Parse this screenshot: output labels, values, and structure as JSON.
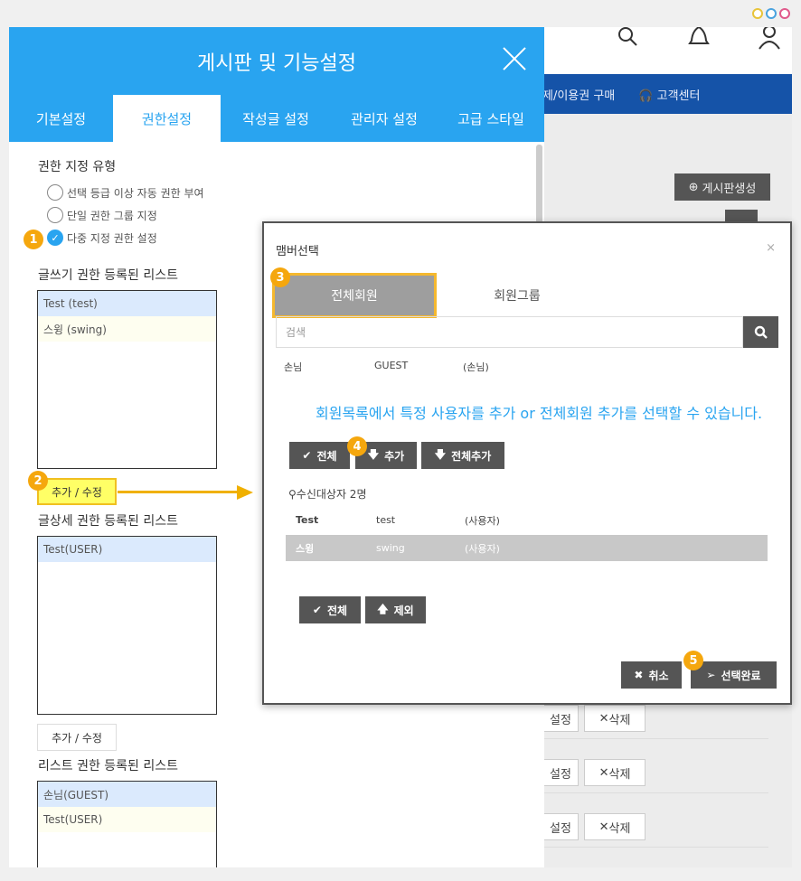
{
  "window_dots": [
    "yellow",
    "blue",
    "pink"
  ],
  "background": {
    "nav_items": [
      "제/이용권 구매",
      "고객센터"
    ],
    "create_board_label": "게시판생성",
    "rows": [
      {
        "edit": "설정",
        "delete": "삭제"
      },
      {
        "edit": "설정",
        "delete": "삭제"
      },
      {
        "edit": "설정",
        "delete": "삭제"
      }
    ]
  },
  "panel": {
    "title": "게시판 및 기능설정",
    "tabs": [
      {
        "label": "기본설정"
      },
      {
        "label": "권한설정"
      },
      {
        "label": "작성글 설정"
      },
      {
        "label": "관리자 설정"
      },
      {
        "label": "고급 스타일"
      }
    ],
    "active_tab": "권한설정",
    "perm_type_label": "권한 지정 유형",
    "radios": [
      {
        "label": "선택 등급 이상 자동 권한 부여",
        "checked": false
      },
      {
        "label": "단일 권한 그룹 지정",
        "checked": false
      },
      {
        "label": "다중 지정 권한 설정",
        "checked": true
      }
    ],
    "write_list_label": "글쓰기 권한 등록된 리스트",
    "write_list": [
      "Test (test)",
      "스윙 (swing)"
    ],
    "detail_list_label": "글상세 권한 등록된 리스트",
    "detail_list": [
      "Test(USER)"
    ],
    "list_list_label": "리스트 권한 등록된 리스트",
    "list_list": [
      "손님(GUEST)",
      "Test(USER)"
    ],
    "edit_button": "추가 / 수정"
  },
  "badges": [
    "1",
    "2",
    "3",
    "4",
    "5"
  ],
  "modal": {
    "title": "맴버선택",
    "close": "×",
    "tabs": [
      "전체회원",
      "회원그룹"
    ],
    "search_placeholder": "검색",
    "member_row": {
      "name": "손님",
      "id": "GUEST",
      "type": "(손님)"
    },
    "info_text": "회원목록에서 특정 사용자를 추가 or 전체회원 추가를 선택할 수 있습니다.",
    "buttons_top": {
      "all": "전체",
      "add": "추가",
      "add_all": "전체추가"
    },
    "recipient_count": "수신대상자 2명",
    "recipients": [
      {
        "name": "Test",
        "id": "test",
        "type": "(사용자)",
        "selected": false
      },
      {
        "name": "스윙",
        "id": "swing",
        "type": "(사용자)",
        "selected": true
      }
    ],
    "buttons_bottom": {
      "all": "전체",
      "remove": "제외"
    },
    "cancel": "취소",
    "done": "선택완료"
  },
  "colors": {
    "accent": "#29a4f0",
    "nav": "#1553a8",
    "highlight": "#f5a70e"
  }
}
